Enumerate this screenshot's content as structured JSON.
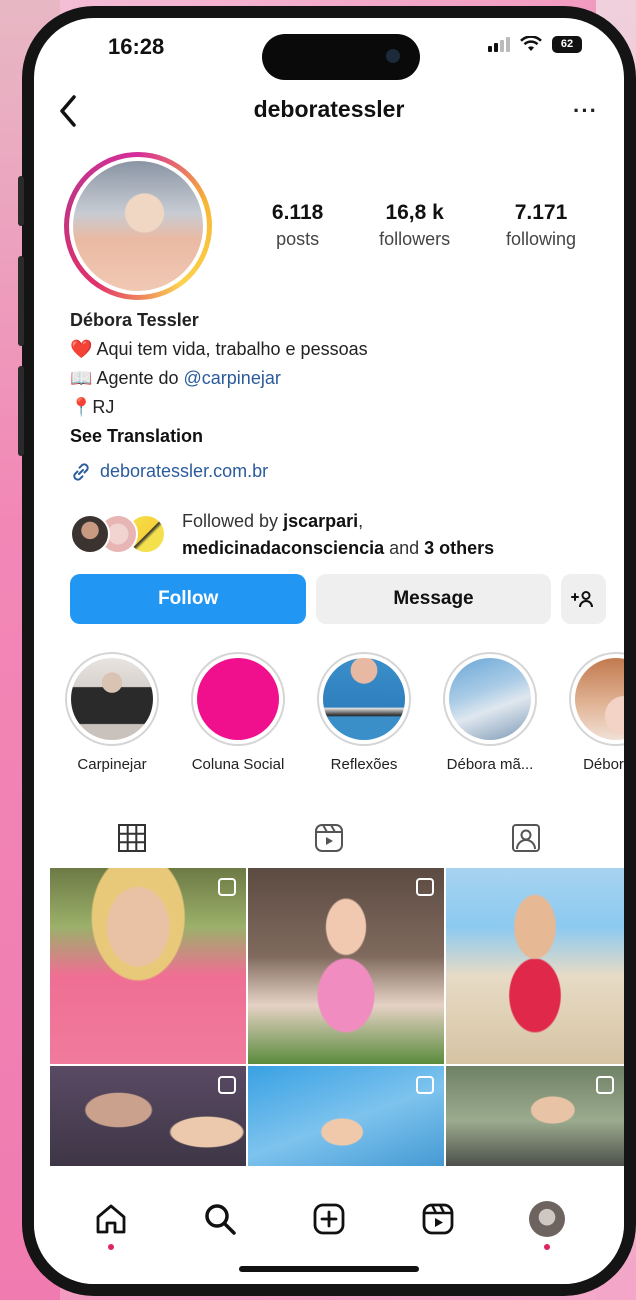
{
  "status": {
    "time": "16:28",
    "battery": "62"
  },
  "header": {
    "username": "deboratessler",
    "more": "···"
  },
  "stats": [
    {
      "value": "6.118",
      "label": "posts"
    },
    {
      "value": "16,8 k",
      "label": "followers"
    },
    {
      "value": "7.171",
      "label": "following"
    }
  ],
  "bio": {
    "name": "Débora Tessler",
    "line1_emoji": "❤️",
    "line1": "Aqui tem vida, trabalho e pessoas",
    "line2_emoji": "📖",
    "line2_prefix": "Agente do ",
    "line2_mention": "@carpinejar",
    "line3_emoji": "📍",
    "line3": "RJ",
    "see_translation": "See Translation",
    "link": "deboratessler.com.br"
  },
  "followed_by": {
    "prefix": "Followed by ",
    "user1": "jscarpari",
    "sep": ",",
    "user2": "medicinadaconsciencia",
    "mid": " and ",
    "others": "3 others"
  },
  "actions": {
    "follow": "Follow",
    "message": "Message",
    "add_user": "+👤"
  },
  "highlights": [
    {
      "label": "Carpinejar"
    },
    {
      "label": "Coluna Social"
    },
    {
      "label": "Reflexões"
    },
    {
      "label": "Débora mã..."
    },
    {
      "label": "Débora m"
    }
  ],
  "colors": {
    "accent": "#2196f3",
    "link": "#2a5b9c",
    "notification": "#e0245e"
  },
  "icons": [
    "back-arrow-icon",
    "more-icon",
    "grid-icon",
    "reels-icon",
    "tagged-icon",
    "home-icon",
    "search-icon",
    "create-icon",
    "reels-nav-icon",
    "profile-avatar"
  ]
}
